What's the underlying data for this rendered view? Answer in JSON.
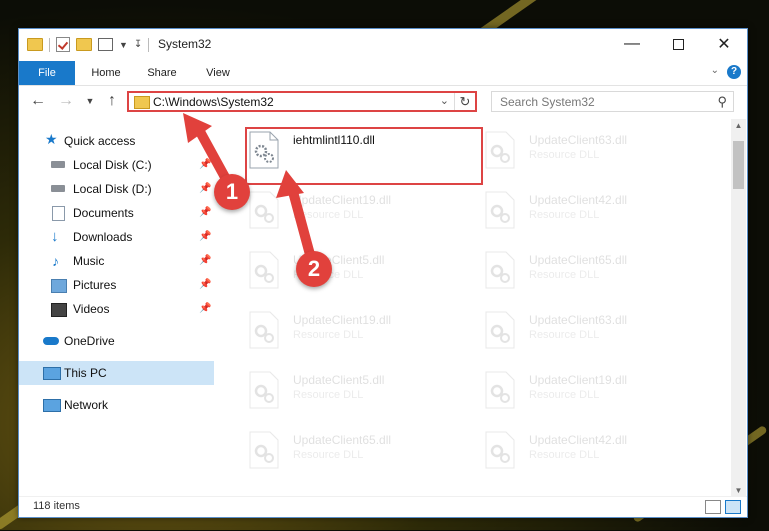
{
  "window": {
    "title": "System32",
    "tabs": [
      "File",
      "Home",
      "Share",
      "View"
    ]
  },
  "address": {
    "path": "C:\\Windows\\System32",
    "search_placeholder": "Search System32"
  },
  "nav": {
    "items": [
      {
        "label": "Quick access",
        "icon": "star-icon"
      },
      {
        "label": "Local Disk (C:)",
        "icon": "drive-icon",
        "pinned": true
      },
      {
        "label": "Local Disk (D:)",
        "icon": "drive-icon",
        "pinned": true
      },
      {
        "label": "Documents",
        "icon": "document-icon",
        "pinned": true
      },
      {
        "label": "Downloads",
        "icon": "download-icon",
        "pinned": true
      },
      {
        "label": "Music",
        "icon": "music-icon",
        "pinned": true
      },
      {
        "label": "Pictures",
        "icon": "pictures-icon",
        "pinned": true
      },
      {
        "label": "Videos",
        "icon": "video-icon",
        "pinned": true
      },
      {
        "label": "OneDrive",
        "icon": "cloud-icon"
      },
      {
        "label": "This PC",
        "icon": "computer-icon",
        "selected": true
      },
      {
        "label": "Network",
        "icon": "network-icon"
      }
    ]
  },
  "files": {
    "highlighted": {
      "name": "iehtmlintl110.dll"
    },
    "left": [
      {
        "name": "UpdateClient19.dll",
        "type": "Resource DLL"
      },
      {
        "name": "UpdateClient5.dll",
        "type": "Resource DLL"
      },
      {
        "name": "UpdateClient19.dll",
        "type": "Resource DLL"
      },
      {
        "name": "UpdateClient5.dll",
        "type": "Resource DLL"
      },
      {
        "name": "UpdateClient65.dll",
        "type": "Resource DLL"
      }
    ],
    "right": [
      {
        "name": "UpdateClient63.dll",
        "type": "Resource DLL"
      },
      {
        "name": "UpdateClient42.dll",
        "type": "Resource DLL"
      },
      {
        "name": "UpdateClient65.dll",
        "type": "Resource DLL"
      },
      {
        "name": "UpdateClient63.dll",
        "type": "Resource DLL"
      },
      {
        "name": "UpdateClient19.dll",
        "type": "Resource DLL"
      },
      {
        "name": "UpdateClient42.dll",
        "type": "Resource DLL"
      }
    ]
  },
  "status": {
    "items": "118 items"
  },
  "annotations": {
    "step1": "1",
    "step2": "2"
  },
  "colors": {
    "accent": "#1979ca",
    "annotation": "#e1413c",
    "selection": "#cce4f7"
  }
}
